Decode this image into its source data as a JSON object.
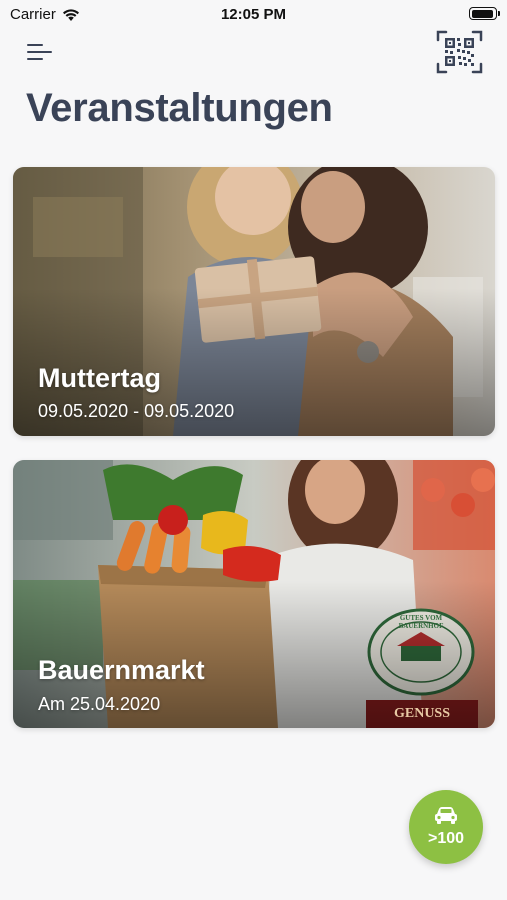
{
  "status_bar": {
    "carrier": "Carrier",
    "time": "12:05 PM"
  },
  "header": {
    "title": "Veranstaltungen",
    "menu_icon": "menu-icon",
    "qr_icon": "qr-code-icon"
  },
  "events": [
    {
      "title": "Muttertag",
      "date": "09.05.2020 - 09.05.2020"
    },
    {
      "title": "Bauernmarkt",
      "date": "Am 25.04.2020",
      "badge_text": "GUTES VOM BAUERNHOF",
      "sign_text": "GENUSS"
    }
  ],
  "fab": {
    "label": ">100",
    "icon": "car-icon",
    "color": "#8dc043"
  },
  "colors": {
    "title": "#3a4357",
    "background": "#f7f7f8"
  }
}
